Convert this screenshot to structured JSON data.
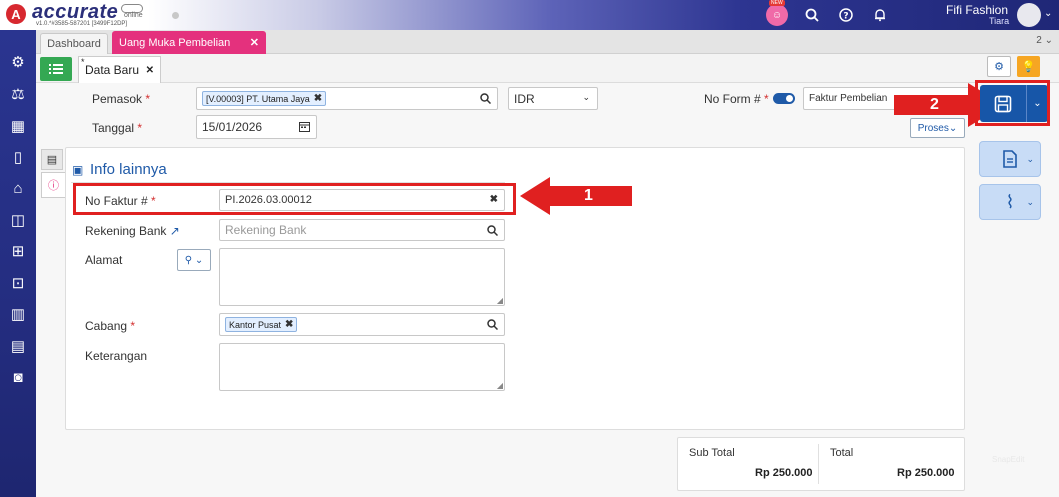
{
  "app": {
    "logo_mark": "A",
    "logo_text": "accurate",
    "logo_sub": "online",
    "version": "v1.0.*#3585-587201 [3499F12DP]"
  },
  "topbar": {
    "new_badge": "NEW",
    "user_name": "Fifi Fashion",
    "user_sub": "Tiara"
  },
  "tabs": {
    "dashboard": "Dashboard",
    "active": "Uang Muka Pembelian",
    "count": "2 ⌄"
  },
  "subtab": {
    "asterisk": "*",
    "label": "Data Baru"
  },
  "form": {
    "pemasok_label": "Pemasok",
    "pemasok_value": "[V.00003] PT. Utama Jaya",
    "currency": "IDR",
    "no_form_label": "No Form #",
    "no_form_value": "Faktur Pembelian",
    "tanggal_label": "Tanggal",
    "tanggal_value": "15/01/2026",
    "proses_label": "Proses"
  },
  "panel": {
    "title": "Info lainnya",
    "no_faktur_label": "No Faktur #",
    "no_faktur_value": "PI.2026.03.00012",
    "rekening_label": "Rekening Bank",
    "rekening_placeholder": "Rekening Bank",
    "alamat_label": "Alamat",
    "cabang_label": "Cabang",
    "cabang_value": "Kantor Pusat",
    "keterangan_label": "Keterangan"
  },
  "annotations": {
    "step1": "1",
    "step2": "2"
  },
  "totals": {
    "subtotal_label": "Sub Total",
    "subtotal_value": "Rp 250.000",
    "total_label": "Total",
    "total_value": "Rp 250.000"
  },
  "watermark": "SnapEdit",
  "colors": {
    "accent": "#1756a8",
    "tab_active": "#e4317d",
    "highlight": "#e02020",
    "list_button": "#34a853",
    "bulb_button": "#f6a623"
  }
}
